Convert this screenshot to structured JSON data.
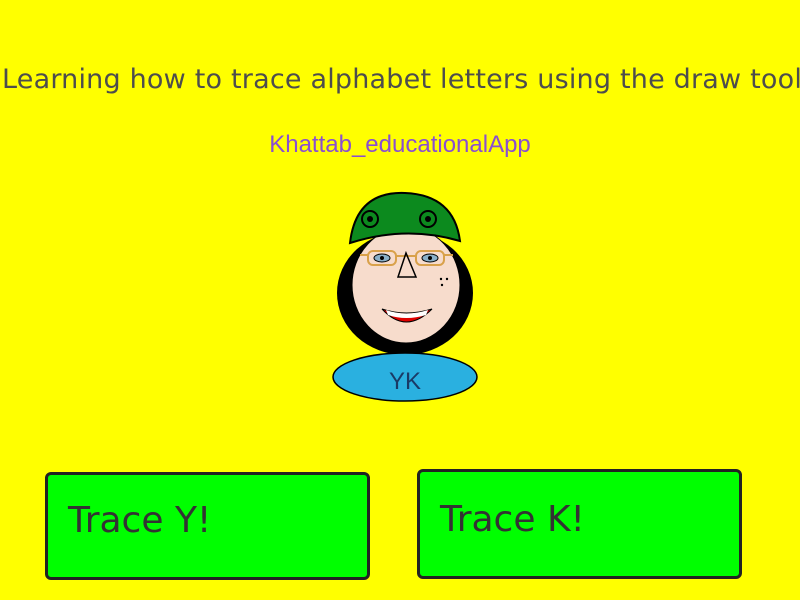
{
  "header": {
    "instruction": "Learning how to trace alphabet letters using the draw tool",
    "app_name": "Khattab_educationalApp"
  },
  "mascot": {
    "initials": "YK"
  },
  "buttons": {
    "trace_y_label": "Trace Y!",
    "trace_k_label": "Trace K!"
  },
  "colors": {
    "background": "#ffff00",
    "button_fill": "#00ff00",
    "app_name": "#8a4fd0",
    "hat": "#0c8a1e",
    "name_badge": "#2ab0e0"
  }
}
